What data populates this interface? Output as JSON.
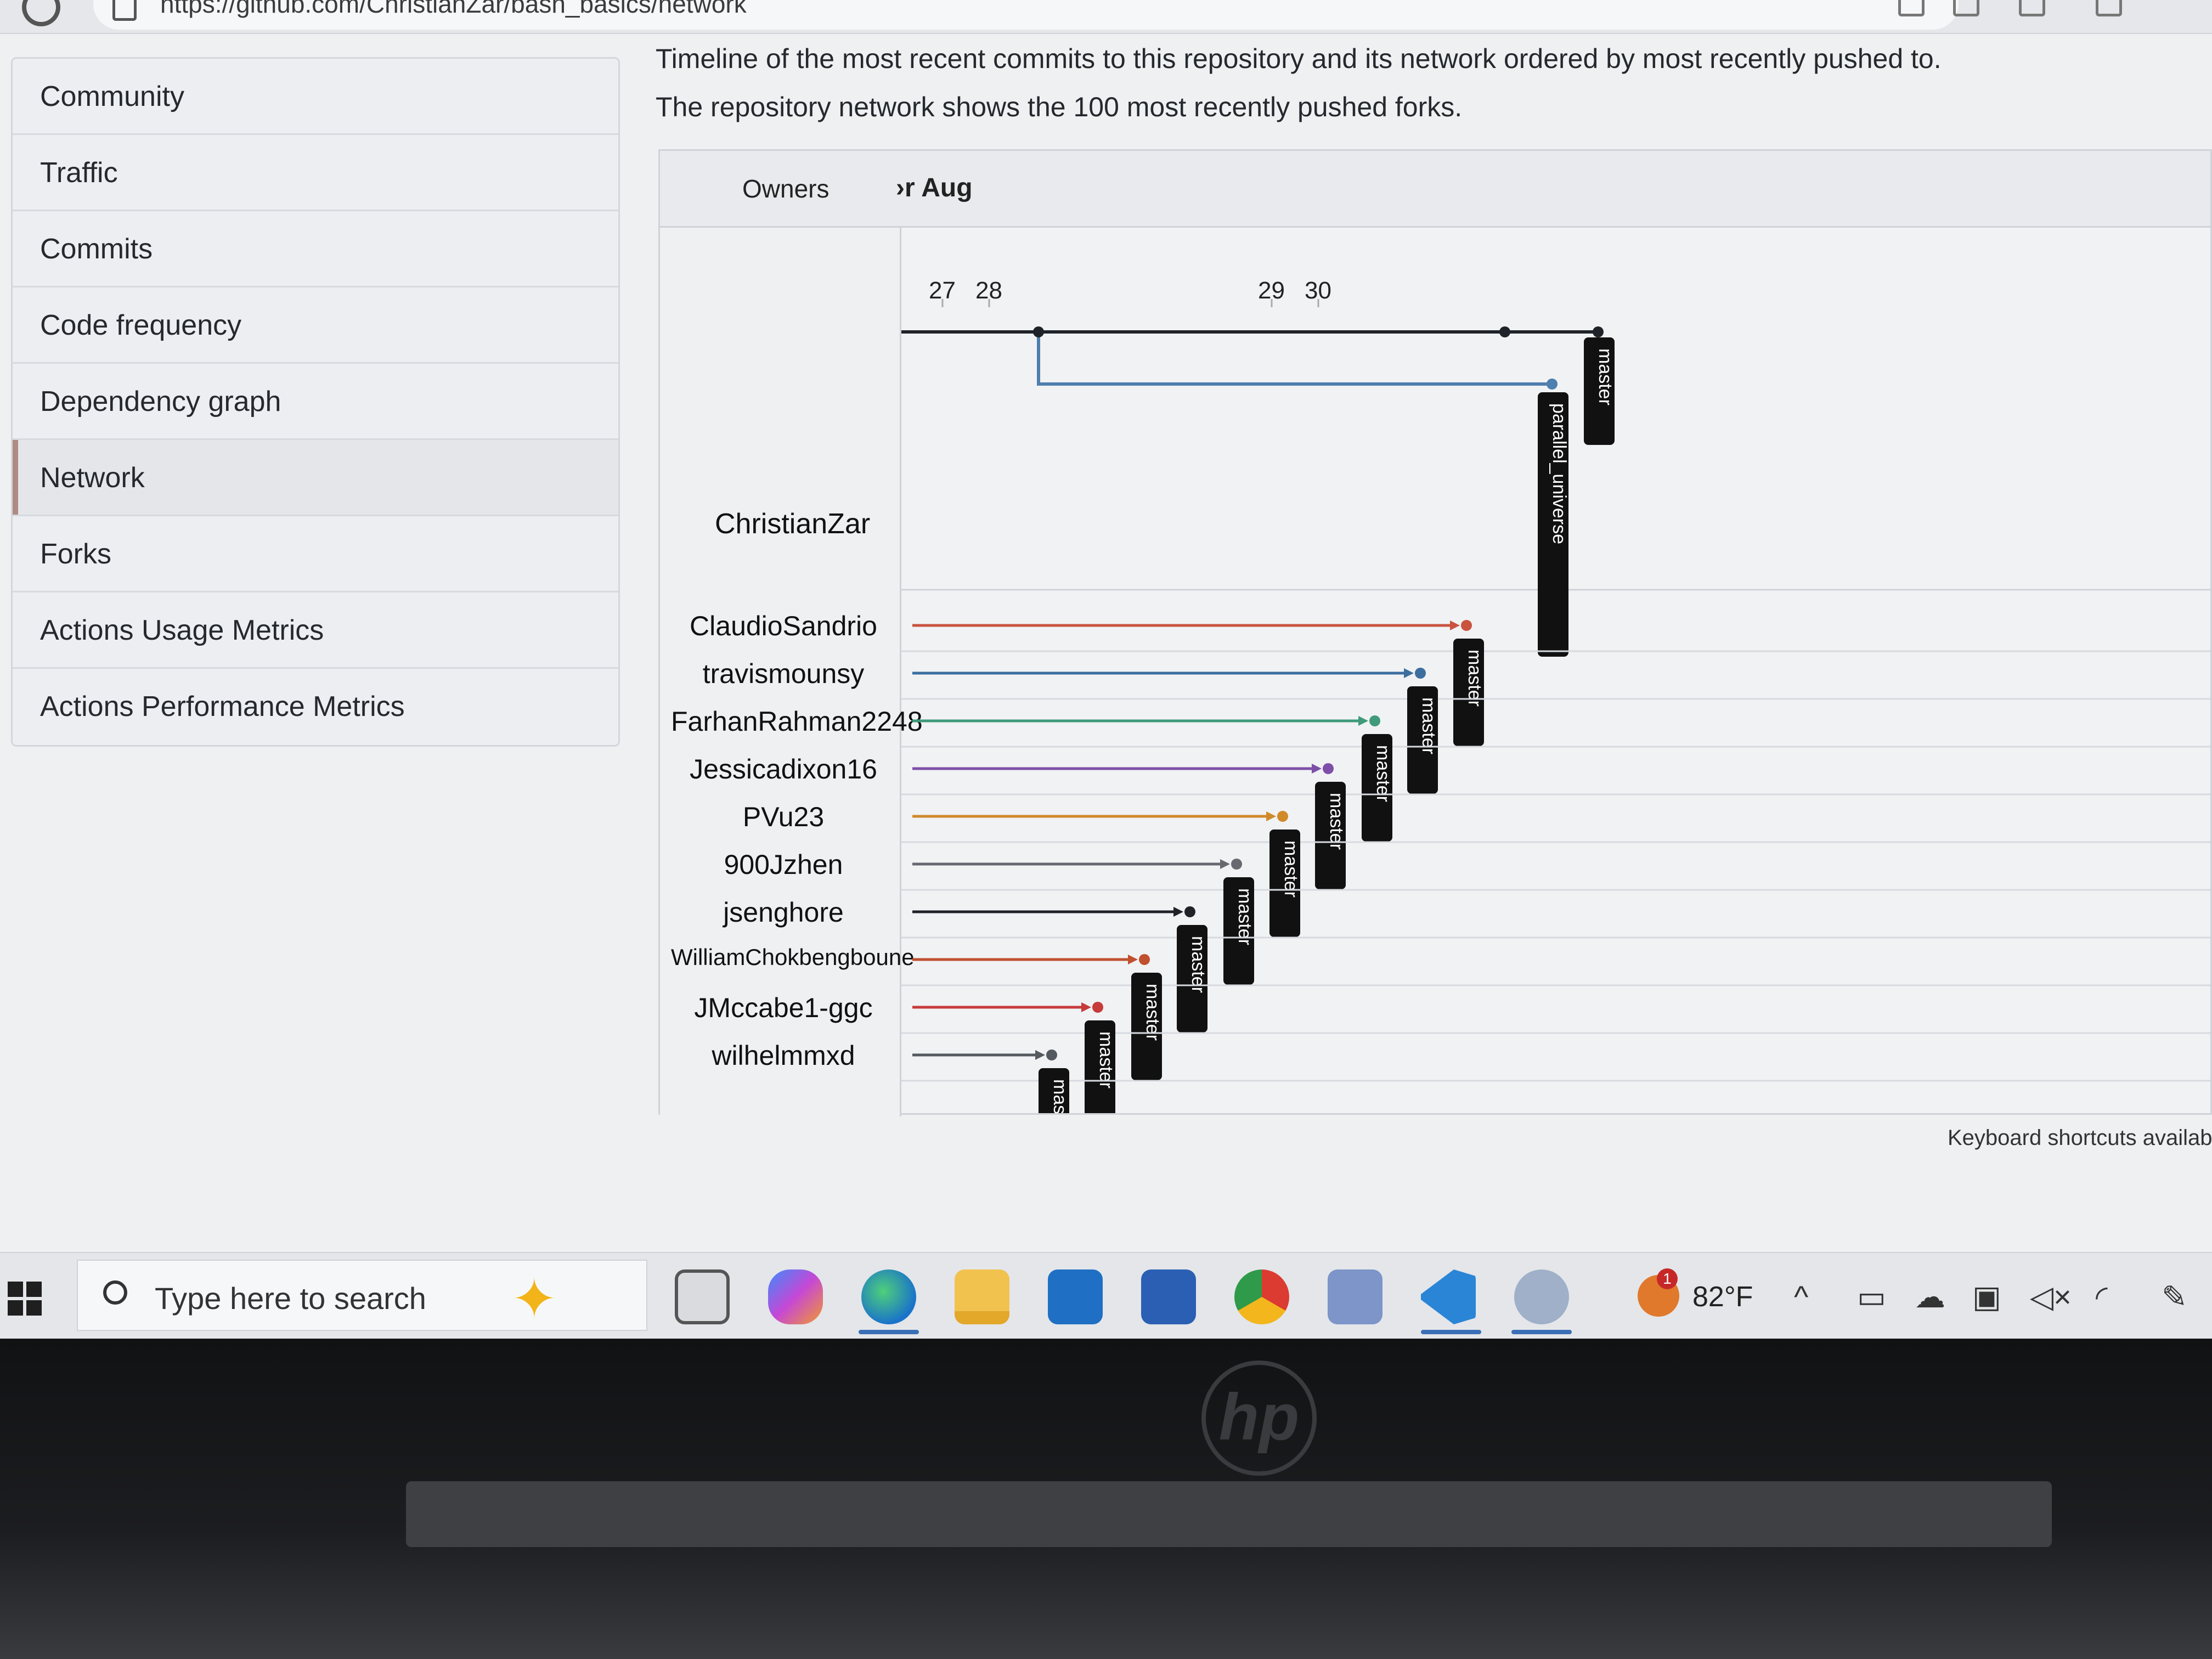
{
  "browser": {
    "url": "https://github.com/ChristianZar/bash_basics/network"
  },
  "sidebar": {
    "items": [
      {
        "label": "Community",
        "selected": false
      },
      {
        "label": "Traffic",
        "selected": false
      },
      {
        "label": "Commits",
        "selected": false
      },
      {
        "label": "Code frequency",
        "selected": false
      },
      {
        "label": "Dependency graph",
        "selected": false
      },
      {
        "label": "Network",
        "selected": true
      },
      {
        "label": "Forks",
        "selected": false
      },
      {
        "label": "Actions Usage Metrics",
        "selected": false
      },
      {
        "label": "Actions Performance Metrics",
        "selected": false
      }
    ]
  },
  "main": {
    "description_1": "Timeline of the most recent commits to this repository and its network ordered by most recently pushed to.",
    "description_2": "The repository network shows the 100 most recently pushed forks."
  },
  "network": {
    "owners_header": "Owners",
    "month_header": "›r Aug",
    "dates": [
      "27",
      "28",
      "29",
      "30"
    ],
    "main_owner": "ChristianZar",
    "main_branches": [
      {
        "name": "master",
        "color": "#1f2328"
      },
      {
        "name": "parallel_universe",
        "color": "#4e7fae"
      }
    ],
    "forks": [
      {
        "owner": "ClaudioSandrio",
        "branch": "master",
        "color": "#c9533f"
      },
      {
        "owner": "travismounsy",
        "branch": "master",
        "color": "#3c6f9f"
      },
      {
        "owner": "FarhanRahman2248",
        "branch": "master",
        "color": "#3f9b7a"
      },
      {
        "owner": "Jessicadixon16",
        "branch": "master",
        "color": "#7d4fa8"
      },
      {
        "owner": "PVu23",
        "branch": "master",
        "color": "#d08a2a"
      },
      {
        "owner": "900Jzhen",
        "branch": "master",
        "color": "#666a70"
      },
      {
        "owner": "jsenghore",
        "branch": "master",
        "color": "#1f2328"
      },
      {
        "owner": "WilliamChokbengboune",
        "branch": "master",
        "color": "#c0502f"
      },
      {
        "owner": "JMccabe1-ggc",
        "branch": "master",
        "color": "#c73b3b"
      },
      {
        "owner": "wilhelmmxd",
        "branch": "mast",
        "color": "#555a60"
      }
    ],
    "keyboard_hint": "Keyboard shortcuts availab"
  },
  "taskbar": {
    "search_placeholder": "Type here to search",
    "apps": [
      "task-view-icon",
      "copilot-icon",
      "edge-icon",
      "file-explorer-icon",
      "outlook-icon",
      "store-icon",
      "chrome-icon",
      "network-app-icon",
      "vscode-icon",
      "snipping-tool-icon"
    ],
    "weather_badge": "1",
    "temperature": "82°F"
  },
  "device": {
    "brand": "hp"
  }
}
